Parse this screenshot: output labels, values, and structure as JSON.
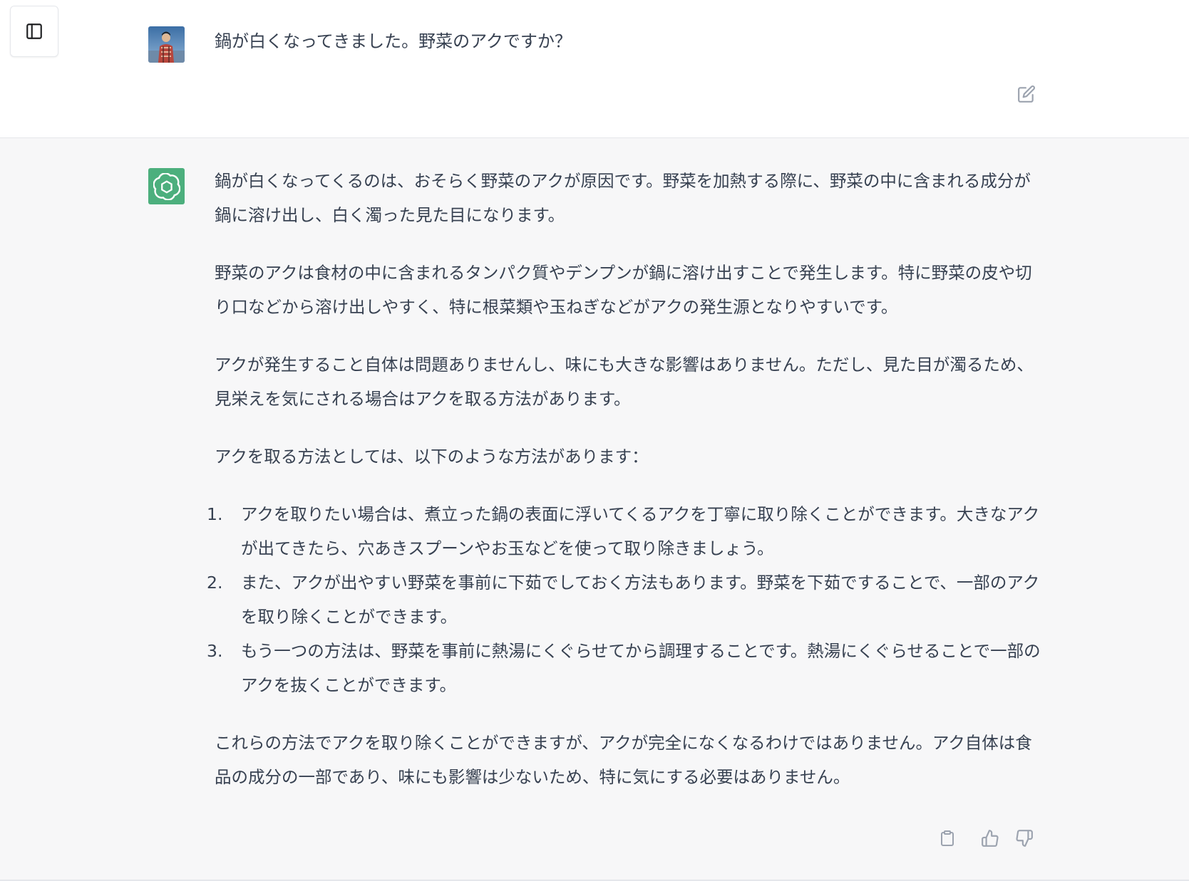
{
  "sidebar_toggle": {
    "icon": "sidebar-icon"
  },
  "user_message": {
    "avatar": "user-avatar-photo",
    "text": "鍋が白くなってきました。野菜のアクですか？",
    "edit_icon": "edit-icon"
  },
  "assistant_message": {
    "avatar": "openai-logo",
    "paragraphs": [
      "鍋が白くなってくるのは、おそらく野菜のアクが原因です。野菜を加熱する際に、野菜の中に含まれる成分が鍋に溶け出し、白く濁った見た目になります。",
      "野菜のアクは食材の中に含まれるタンパク質やデンプンが鍋に溶け出すことで発生します。特に野菜の皮や切り口などから溶け出しやすく、特に根菜類や玉ねぎなどがアクの発生源となりやすいです。",
      "アクが発生すること自体は問題ありませんし、味にも大きな影響はありません。ただし、見た目が濁るため、見栄えを気にされる場合はアクを取る方法があります。",
      "アクを取る方法としては、以下のような方法があります："
    ],
    "list": [
      {
        "num": "1.",
        "text": "アクを取りたい場合は、煮立った鍋の表面に浮いてくるアクを丁寧に取り除くことができます。大きなアクが出てきたら、穴あきスプーンやお玉などを使って取り除きましょう。"
      },
      {
        "num": "2.",
        "text": "また、アクが出やすい野菜を事前に下茹でしておく方法もあります。野菜を下茹ですることで、一部のアクを取り除くことができます。"
      },
      {
        "num": "3.",
        "text": "もう一つの方法は、野菜を事前に熱湯にくぐらせてから調理することです。熱湯にくぐらせることで一部のアクを抜くことができます。"
      }
    ],
    "closing": "これらの方法でアクを取り除くことができますが、アクが完全になくなるわけではありません。アク自体は食品の成分の一部であり、味にも影響は少ないため、特に気にする必要はありません。",
    "actions": [
      "copy-icon",
      "thumbs-up-icon",
      "thumbs-down-icon"
    ]
  },
  "colors": {
    "assistant_bg": "#f7f7f8",
    "gpt_avatar": "#4caf7d",
    "text": "#374151",
    "icon": "#9ca3af"
  }
}
